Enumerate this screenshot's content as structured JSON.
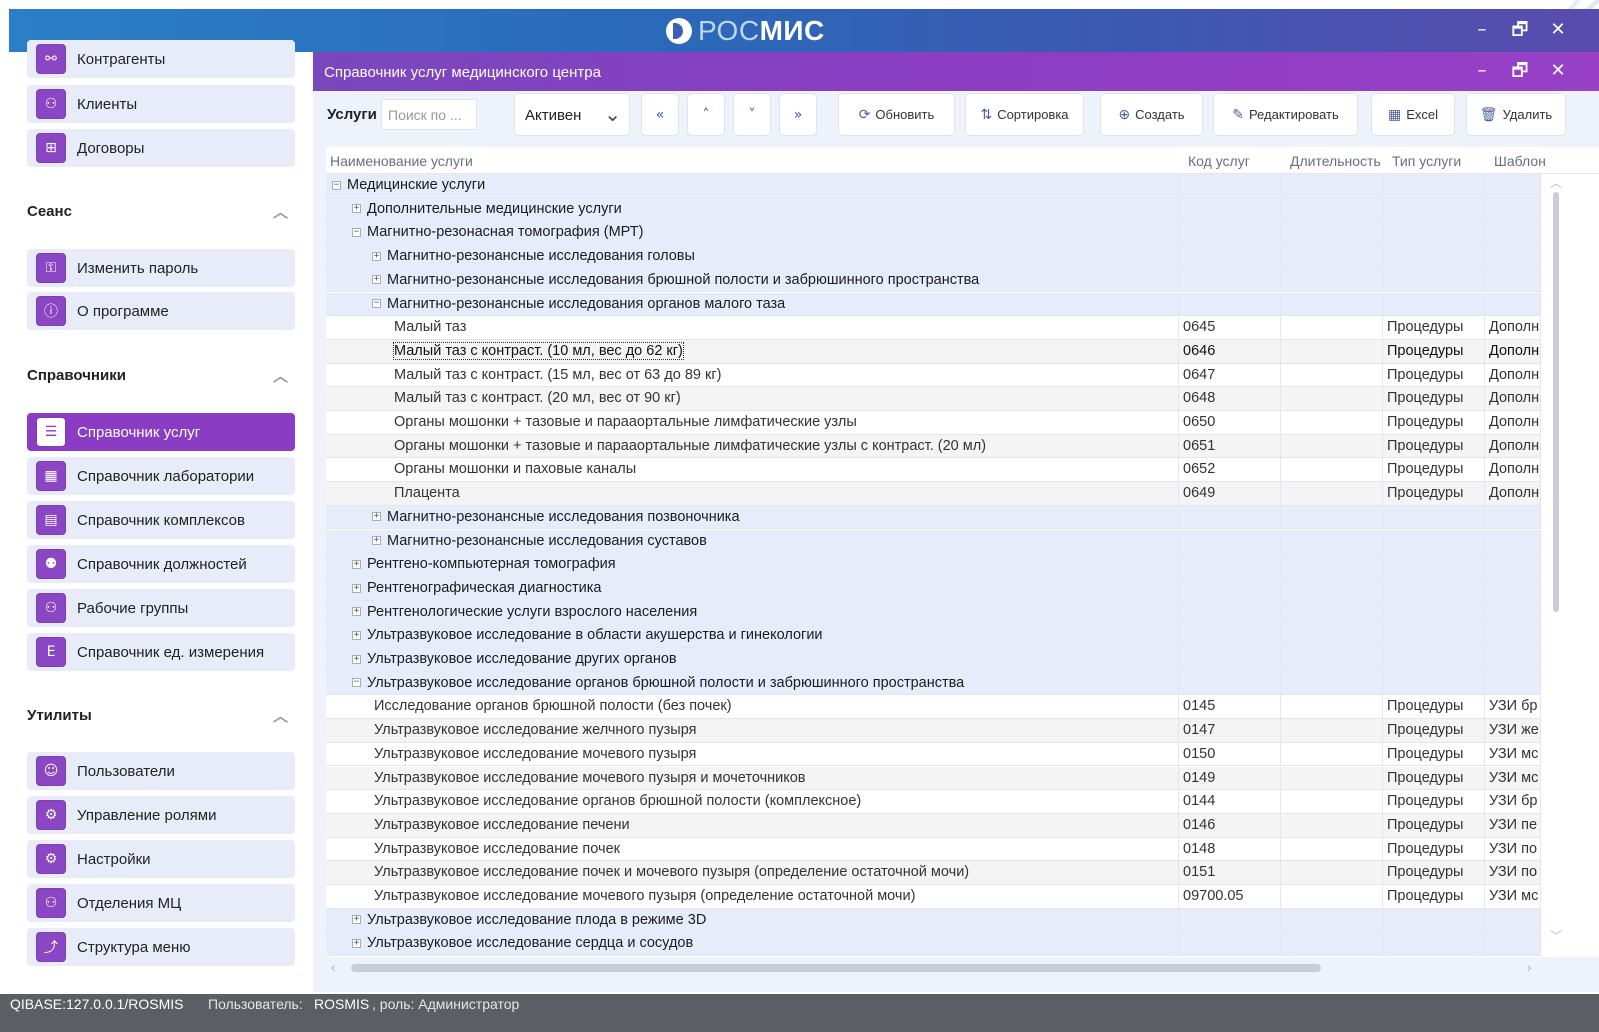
{
  "app": {
    "logo_prefix": "РОС",
    "logo_suffix": "МИС",
    "window_controls": [
      "–",
      "🗗",
      "✕"
    ]
  },
  "sidebar": {
    "top_items": [
      {
        "label": "Контрагенты",
        "icon": "contractors-icon"
      },
      {
        "label": "Клиенты",
        "icon": "clients-icon"
      },
      {
        "label": "Договоры",
        "icon": "contracts-icon"
      }
    ],
    "sections": [
      {
        "title": "Сеанс",
        "items": [
          {
            "label": "Изменить пароль",
            "icon": "change-password-icon"
          },
          {
            "label": "О программе",
            "icon": "about-icon"
          }
        ]
      },
      {
        "title": "Справочники",
        "items": [
          {
            "label": "Справочник услуг",
            "icon": "services-icon",
            "active": true
          },
          {
            "label": "Справочник лаборатории",
            "icon": "laboratory-icon"
          },
          {
            "label": "Справочник комплексов",
            "icon": "complexes-icon"
          },
          {
            "label": "Справочник должностей",
            "icon": "positions-icon"
          },
          {
            "label": "Рабочие группы",
            "icon": "work-groups-icon"
          },
          {
            "label": "Справочник ед. измерения",
            "icon": "units-icon"
          }
        ]
      },
      {
        "title": "Утилиты",
        "items": [
          {
            "label": "Пользователи",
            "icon": "users-icon"
          },
          {
            "label": "Управление ролями",
            "icon": "roles-icon"
          },
          {
            "label": "Настройки",
            "icon": "settings-icon"
          },
          {
            "label": "Отделения МЦ",
            "icon": "departments-icon"
          },
          {
            "label": "Структура меню",
            "icon": "menu-structure-icon"
          }
        ]
      }
    ]
  },
  "window": {
    "title": "Справочник услуг медицинского центра"
  },
  "toolbar": {
    "label": "Услуги",
    "search_placeholder": "Поиск по ...",
    "status_value": "Активен",
    "nav": [
      "«",
      "˄",
      "˅",
      "»"
    ],
    "refresh": "Обновить",
    "sort": "Сортировка",
    "create": "Создать",
    "edit": "Редактировать",
    "excel": "Excel",
    "delete": "Удалить"
  },
  "grid": {
    "headers": [
      "Наименование услуги",
      "Код услуг",
      "Длительность",
      "Тип услуги",
      "Шаблон"
    ],
    "rows": [
      {
        "level": 0,
        "type": "grp",
        "exp": "−",
        "name": "Медицинские услуги"
      },
      {
        "level": 1,
        "type": "grp",
        "exp": "+",
        "name": "Дополнительные медицинские услуги"
      },
      {
        "level": 1,
        "type": "grp",
        "exp": "−",
        "name": "Магнитно-резонасная томография (МРТ)"
      },
      {
        "level": 2,
        "type": "grp",
        "exp": "+",
        "name": "Магнитно-резонансные исследования головы"
      },
      {
        "level": 2,
        "type": "grp",
        "exp": "+",
        "name": "Магнитно-резонансные исследования брюшной полости и забрюшинного пространства"
      },
      {
        "level": 2,
        "type": "grp",
        "exp": "−",
        "name": "Магнитно-резонансные исследования органов малого таза"
      },
      {
        "level": 3,
        "type": "leaf",
        "name": "Малый таз",
        "code": "0645",
        "kind": "Процедуры",
        "tpl": "Дополн"
      },
      {
        "level": 3,
        "type": "leaf",
        "sel": true,
        "name": "Малый таз с контраст. (10 мл, вес до 62 кг)",
        "code": "0646",
        "kind": "Процедуры",
        "tpl": "Дополн"
      },
      {
        "level": 3,
        "type": "leaf",
        "name": "Малый таз с контраст. (15 мл, вес от 63 до 89 кг)",
        "code": "0647",
        "kind": "Процедуры",
        "tpl": "Дополн"
      },
      {
        "level": 3,
        "type": "leaf",
        "name": "Малый таз с контраст. (20 мл, вес от 90 кг)",
        "code": "0648",
        "kind": "Процедуры",
        "tpl": "Дополн"
      },
      {
        "level": 3,
        "type": "leaf",
        "name": "Органы мошонки + тазовые и парааортальные лимфатические узлы",
        "code": "0650",
        "kind": "Процедуры",
        "tpl": "Дополн"
      },
      {
        "level": 3,
        "type": "leaf",
        "name": "Органы мошонки + тазовые и парааортальные лимфатические узлы с контраст. (20 мл)",
        "code": "0651",
        "kind": "Процедуры",
        "tpl": "Дополн"
      },
      {
        "level": 3,
        "type": "leaf",
        "name": "Органы мошонки и паховые каналы",
        "code": "0652",
        "kind": "Процедуры",
        "tpl": "Дополн"
      },
      {
        "level": 3,
        "type": "leaf",
        "name": "Плацента",
        "code": "0649",
        "kind": "Процедуры",
        "tpl": "Дополн"
      },
      {
        "level": 2,
        "type": "grp",
        "exp": "+",
        "name": "Магнитно-резонансные исследования позвоночника"
      },
      {
        "level": 2,
        "type": "grp",
        "exp": "+",
        "name": "Магнитно-резонансные исследования суставов"
      },
      {
        "level": 1,
        "type": "grp",
        "exp": "+",
        "name": "Рентгено-компьютерная томография"
      },
      {
        "level": 1,
        "type": "grp",
        "exp": "+",
        "name": "Рентгенографическая диагностика"
      },
      {
        "level": 1,
        "type": "grp",
        "exp": "+",
        "name": "Рентгенологические услуги взрослого населения"
      },
      {
        "level": 1,
        "type": "grp",
        "exp": "+",
        "name": "Ультразвуковое исследование в области акушерства и гинекологии"
      },
      {
        "level": 1,
        "type": "grp",
        "exp": "+",
        "name": "Ультразвуковое исследование других органов"
      },
      {
        "level": 1,
        "type": "grp",
        "exp": "−",
        "name": "Ультразвуковое исследование органов брюшной полости и забрюшинного пространства"
      },
      {
        "level": 2,
        "type": "leaf",
        "name": "Исследование органов брюшной полости (без почек)",
        "code": "0145",
        "kind": "Процедуры",
        "tpl": "УЗИ бр"
      },
      {
        "level": 2,
        "type": "leaf",
        "name": "Ультразвуковое исследование желчного пузыря",
        "code": "0147",
        "kind": "Процедуры",
        "tpl": "УЗИ же"
      },
      {
        "level": 2,
        "type": "leaf",
        "name": "Ультразвуковое исследование мочевого пузыря",
        "code": "0150",
        "kind": "Процедуры",
        "tpl": "УЗИ мс"
      },
      {
        "level": 2,
        "type": "leaf",
        "name": "Ультразвуковое исследование мочевого пузыря и мочеточников",
        "code": "0149",
        "kind": "Процедуры",
        "tpl": "УЗИ мс"
      },
      {
        "level": 2,
        "type": "leaf",
        "name": "Ультразвуковое исследование органов брюшной полости (комплексное)",
        "code": "0144",
        "kind": "Процедуры",
        "tpl": "УЗИ бр"
      },
      {
        "level": 2,
        "type": "leaf",
        "name": "Ультразвуковое исследование печени",
        "code": "0146",
        "kind": "Процедуры",
        "tpl": "УЗИ пе"
      },
      {
        "level": 2,
        "type": "leaf",
        "name": "Ультразвуковое исследование почек",
        "code": "0148",
        "kind": "Процедуры",
        "tpl": "УЗИ по"
      },
      {
        "level": 2,
        "type": "leaf",
        "name": "Ультразвуковое исследование почек и мочевого пузыря (определение остаточной мочи)",
        "code": "0151",
        "kind": "Процедуры",
        "tpl": "УЗИ по"
      },
      {
        "level": 2,
        "type": "leaf",
        "name": "Ультразвуковое исследование мочевого пузыря (определение остаточной мочи)",
        "code": "09700.05",
        "kind": "Процедуры",
        "tpl": "УЗИ мс"
      },
      {
        "level": 1,
        "type": "grp",
        "exp": "+",
        "name": "Ультразвуковое исследование плода в режиме 3D"
      },
      {
        "level": 1,
        "type": "grp",
        "exp": "+",
        "name": "Ультразвуковое исследование сердца и сосудов"
      }
    ]
  },
  "status": {
    "db": "QIBASE:127.0.0.1/ROSMIS",
    "user_label": "Пользователь:",
    "user": "ROSMIS",
    "role_label": ", роль: Администратор"
  }
}
